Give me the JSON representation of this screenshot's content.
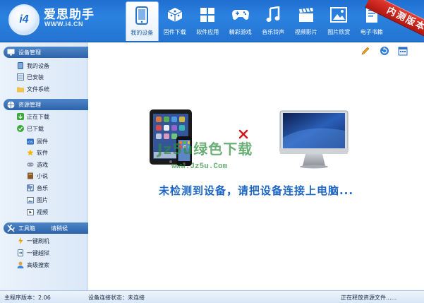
{
  "app": {
    "title": "爱思助手",
    "url": "WWW.i4.CN",
    "logo_text": "i4",
    "beta_label": "内测版本"
  },
  "nav": [
    {
      "label": "我的设备",
      "icon": "phone-device-icon",
      "active": true
    },
    {
      "label": "固件下载",
      "icon": "dice-box-icon"
    },
    {
      "label": "软件应用",
      "icon": "app-grid-icon"
    },
    {
      "label": "精彩游戏",
      "icon": "gamepad-icon"
    },
    {
      "label": "音乐铃声",
      "icon": "music-note-icon"
    },
    {
      "label": "视频影片",
      "icon": "clapperboard-icon"
    },
    {
      "label": "图片欣赏",
      "icon": "picture-icon"
    },
    {
      "label": "电子书籍",
      "icon": "ebook-icon"
    }
  ],
  "sidebar": {
    "device_section": {
      "title": "设备管理",
      "items": [
        {
          "label": "我的设备",
          "icon": "device-icon"
        },
        {
          "label": "已安装",
          "icon": "installed-icon"
        },
        {
          "label": "文件系统",
          "icon": "folder-icon"
        }
      ]
    },
    "resource_section": {
      "title": "资源管理",
      "items": [
        {
          "label": "正在下载",
          "icon": "download-icon"
        },
        {
          "label": "已下载",
          "icon": "check-icon"
        }
      ],
      "sub_items": [
        {
          "label": "固件",
          "icon": "ios-firmware-icon"
        },
        {
          "label": "软件",
          "icon": "star-icon"
        },
        {
          "label": "游戏",
          "icon": "game-icon"
        },
        {
          "label": "小说",
          "icon": "book-icon"
        },
        {
          "label": "音乐",
          "icon": "music-icon"
        },
        {
          "label": "图片",
          "icon": "image-icon"
        },
        {
          "label": "视频",
          "icon": "video-icon"
        }
      ]
    },
    "tools_section": {
      "title": "工具箱",
      "extra": "请稍候",
      "items": [
        {
          "label": "一键刷机",
          "icon": "flash-icon"
        },
        {
          "label": "一键越狱",
          "icon": "jailbreak-icon"
        },
        {
          "label": "高级搜索",
          "icon": "user-search-icon"
        }
      ]
    }
  },
  "main": {
    "message": "未检测到设备，请把设备连接上电脑...",
    "watermark": "Jz5u绿色下载",
    "watermark_url": "www.Jz5u.Com",
    "tools": [
      {
        "name": "edit-icon"
      },
      {
        "name": "refresh-icon"
      },
      {
        "name": "calendar-icon"
      }
    ]
  },
  "status": {
    "version": "主程序版本：2.06",
    "connection": "设备连接状态：未连接",
    "activity": "正在释放资源文件......"
  },
  "colors": {
    "header_blue": "#2373d2",
    "accent_blue": "#1d66c4",
    "beta_red": "#c91e15",
    "watermark_green": "#2c8c3c"
  }
}
